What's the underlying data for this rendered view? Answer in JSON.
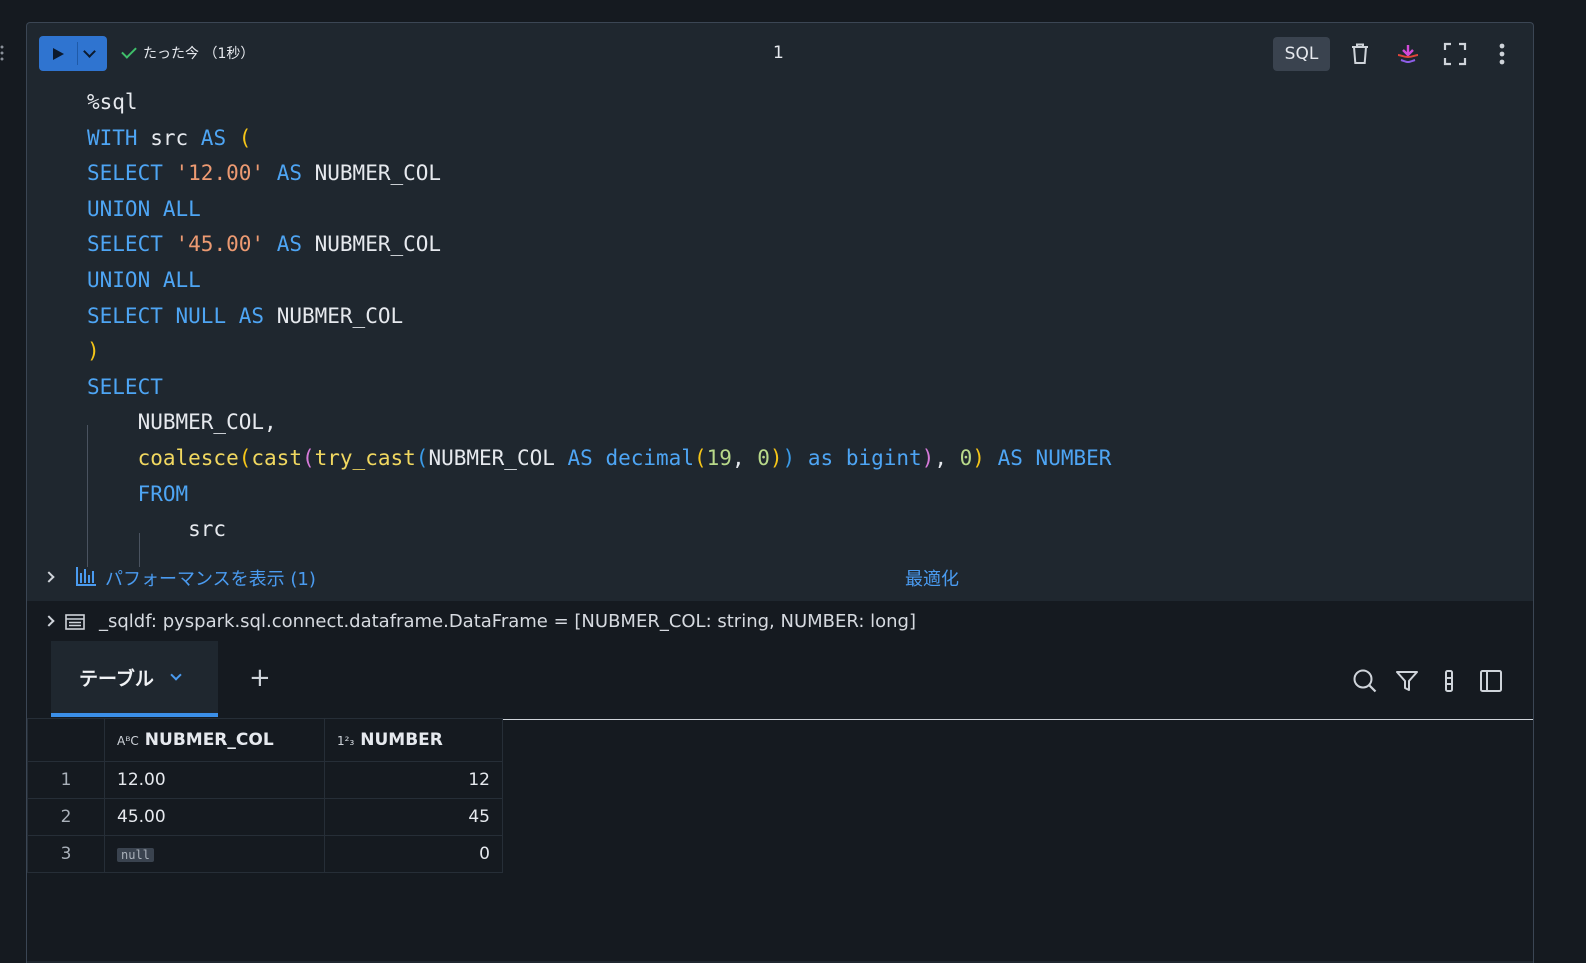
{
  "cell": {
    "status": "たった今 （1秒）",
    "number": "1",
    "language": "SQL"
  },
  "icons": {
    "run": "play-icon",
    "run_menu": "chevron-down-icon",
    "status": "check-icon",
    "delete": "trash-icon",
    "assistant": "assistant-icon",
    "fullscreen": "expand-icon",
    "more": "kebab-menu-icon"
  },
  "code": {
    "lines": [
      "%sql",
      "WITH src AS (",
      "SELECT '12.00' AS NUBMER_COL",
      "UNION ALL",
      "SELECT '45.00' AS NUBMER_COL",
      "UNION ALL",
      "SELECT NULL AS NUBMER_COL",
      ")",
      "SELECT",
      "    NUBMER_COL,",
      "    coalesce(cast(try_cast(NUBMER_COL AS decimal(19, 0)) as bigint), 0) AS NUMBER",
      "    FROM",
      "        src"
    ]
  },
  "performance": {
    "label": "パフォーマンスを表示 (1)",
    "optimize": "最適化"
  },
  "dataframe": {
    "text": "_sqldf:  pyspark.sql.connect.dataframe.DataFrame = [NUBMER_COL: string, NUMBER: long]"
  },
  "results": {
    "tab_label": "テーブル",
    "add_tab": "+",
    "columns": [
      {
        "name": "NUBMER_COL",
        "type_icon": "AᴮC"
      },
      {
        "name": "NUMBER",
        "type_icon": "1²₃"
      }
    ],
    "rows": [
      {
        "index": "1",
        "NUBMER_COL": "12.00",
        "NUMBER": "12"
      },
      {
        "index": "2",
        "NUBMER_COL": "45.00",
        "NUMBER": "45"
      },
      {
        "index": "3",
        "NUBMER_COL": "null",
        "NUMBER": "0"
      }
    ]
  },
  "colors": {
    "accent": "#2f74d0",
    "keyword": "#4ea5f4",
    "string": "#ec9a72",
    "function": "#f1d860",
    "success": "#3fbf6a"
  }
}
